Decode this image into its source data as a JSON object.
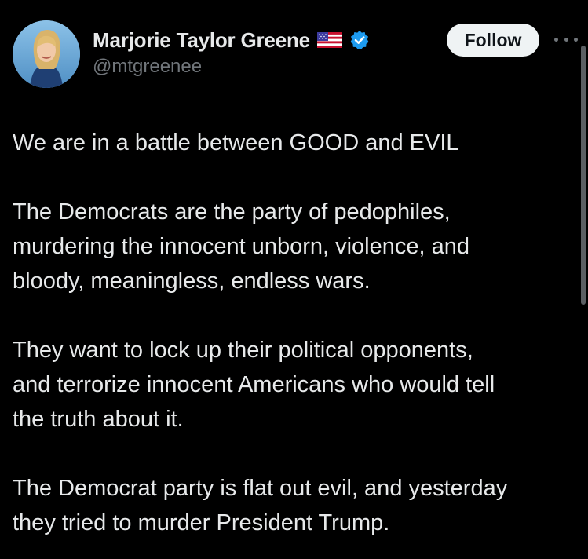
{
  "author": {
    "display_name": "Marjorie Taylor Greene",
    "handle": "@mtgreenee",
    "flag_icon": "us-flag-icon",
    "verified_icon": "verified-badge-icon",
    "verified_color": "#1d9bf0"
  },
  "actions": {
    "follow_label": "Follow",
    "more_icon": "more-options-icon"
  },
  "tweet": {
    "paragraphs": [
      "We are in a battle between GOOD and EVIL",
      "The Democrats are the party of pedophiles,\nmurdering the innocent unborn, violence, and\nbloody, meaningless, endless wars.",
      "They want to lock up their political opponents,\nand terrorize innocent Americans who would tell\nthe truth about it.",
      "The Democrat party is flat out evil, and yesterday\nthey tried to murder President Trump."
    ]
  },
  "theme": {
    "background": "#000000",
    "text": "#e7e9ea",
    "secondary_text": "#71767b",
    "follow_button_bg": "#eff3f4"
  }
}
